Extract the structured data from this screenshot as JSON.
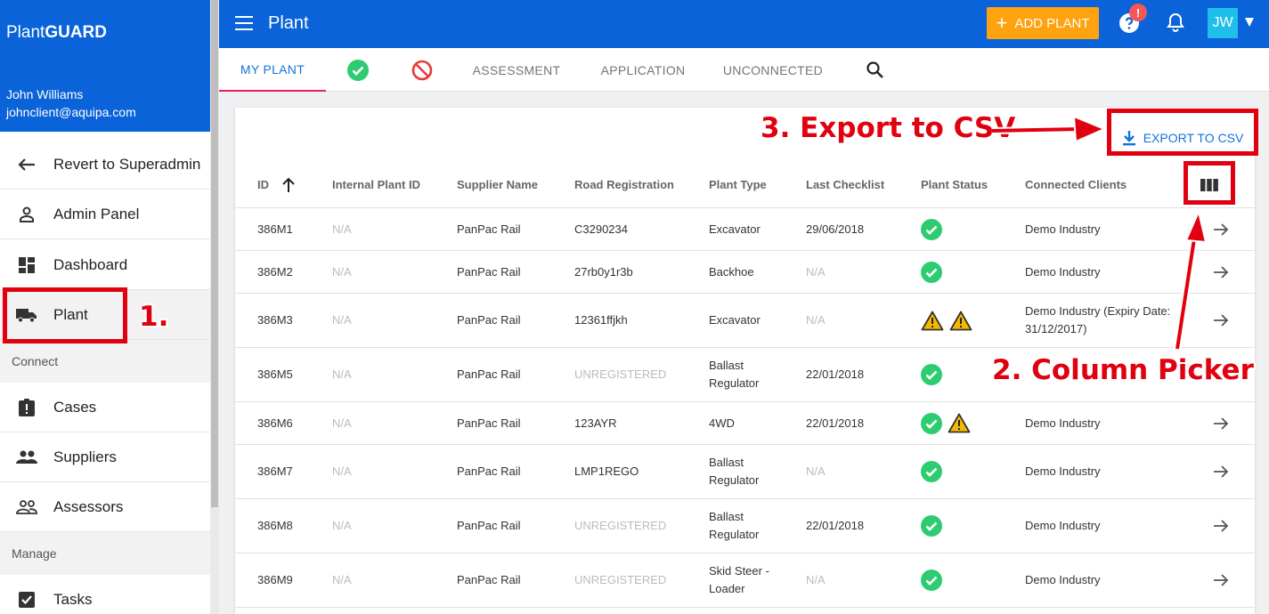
{
  "brand": {
    "prefix": "Plant",
    "suffix": "GUARD"
  },
  "user": {
    "name": "John Williams",
    "email": "johnclient@aquipa.com"
  },
  "nav": {
    "revert": "Revert to Superadmin",
    "admin": "Admin Panel",
    "dashboard": "Dashboard",
    "plant": "Plant",
    "section_connect": "Connect",
    "cases": "Cases",
    "suppliers": "Suppliers",
    "assessors": "Assessors",
    "section_manage": "Manage",
    "tasks": "Tasks"
  },
  "topbar": {
    "title": "Plant",
    "add_label": "ADD PLANT",
    "help_badge": "!",
    "avatar": "JW"
  },
  "tabs": {
    "my_plant": "MY PLANT",
    "assessment": "ASSESSMENT",
    "application": "APPLICATION",
    "unconnected": "UNCONNECTED"
  },
  "toolbar": {
    "export_label": "EXPORT TO CSV"
  },
  "table": {
    "headers": {
      "id": "ID",
      "internal": "Internal Plant ID",
      "supplier": "Supplier Name",
      "road": "Road Registration",
      "type": "Plant Type",
      "checklist": "Last Checklist",
      "status": "Plant Status",
      "clients": "Connected Clients"
    },
    "rows": [
      {
        "id": "386M1",
        "internal": "N/A",
        "supplier": "PanPac Rail",
        "road": "C3290234",
        "type_1": "Excavator",
        "type_2": "",
        "checklist": "29/06/2018",
        "status": [
          "ok"
        ],
        "clients_1": "Demo Industry",
        "clients_2": ""
      },
      {
        "id": "386M2",
        "internal": "N/A",
        "supplier": "PanPac Rail",
        "road": "27rb0y1r3b",
        "type_1": "Backhoe",
        "type_2": "",
        "checklist": "N/A",
        "status": [
          "ok"
        ],
        "clients_1": "Demo Industry",
        "clients_2": ""
      },
      {
        "id": "386M3",
        "internal": "N/A",
        "supplier": "PanPac Rail",
        "road": "12361ffjkh",
        "type_1": "Excavator",
        "type_2": "",
        "checklist": "N/A",
        "status": [
          "warn",
          "warn"
        ],
        "clients_1": "Demo Industry (Expiry Date:",
        "clients_2": "31/12/2017)"
      },
      {
        "id": "386M5",
        "internal": "N/A",
        "supplier": "PanPac Rail",
        "road": "UNREGISTERED",
        "type_1": "Ballast",
        "type_2": "Regulator",
        "checklist": "22/01/2018",
        "status": [
          "ok"
        ],
        "clients_1": "",
        "clients_2": ""
      },
      {
        "id": "386M6",
        "internal": "N/A",
        "supplier": "PanPac Rail",
        "road": "123AYR",
        "type_1": "4WD",
        "type_2": "",
        "checklist": "22/01/2018",
        "status": [
          "ok",
          "warn"
        ],
        "clients_1": "Demo Industry",
        "clients_2": ""
      },
      {
        "id": "386M7",
        "internal": "N/A",
        "supplier": "PanPac Rail",
        "road": "LMP1REGO",
        "type_1": "Ballast",
        "type_2": "Regulator",
        "checklist": "N/A",
        "status": [
          "ok"
        ],
        "clients_1": "Demo Industry",
        "clients_2": ""
      },
      {
        "id": "386M8",
        "internal": "N/A",
        "supplier": "PanPac Rail",
        "road": "UNREGISTERED",
        "type_1": "Ballast",
        "type_2": "Regulator",
        "checklist": "22/01/2018",
        "status": [
          "ok"
        ],
        "clients_1": "Demo Industry",
        "clients_2": ""
      },
      {
        "id": "386M9",
        "internal": "N/A",
        "supplier": "PanPac Rail",
        "road": "UNREGISTERED",
        "type_1": "Skid Steer -",
        "type_2": "Loader",
        "checklist": "N/A",
        "status": [
          "ok"
        ],
        "clients_1": "Demo Industry",
        "clients_2": ""
      }
    ]
  },
  "annotations": {
    "step1": "1.",
    "step2": "2. Column Picker",
    "step3": "3. Export to CSV"
  },
  "colors": {
    "primary": "#0a63d8",
    "accent": "#fea20f",
    "ok": "#2ecc71",
    "warn": "#f5b800",
    "annotation": "#e1000f",
    "active_tab": "#1273de"
  }
}
